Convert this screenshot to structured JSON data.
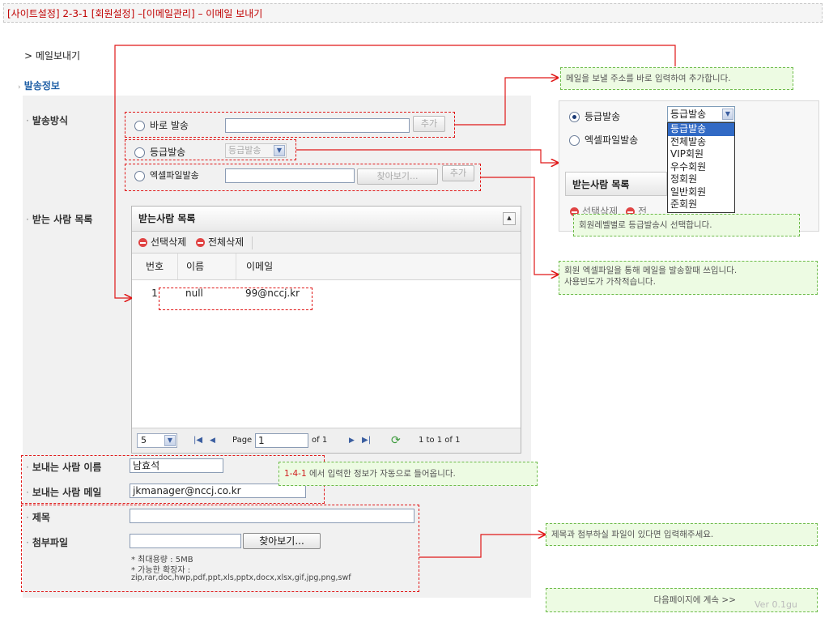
{
  "header": {
    "title": "[사이트설정] 2-3-1 [회원설정] –[이메일관리] – 이메일 보내기"
  },
  "breadcrumb": "> 메일보내기",
  "section_title": "발송정보",
  "send_method": {
    "label": "발송방식",
    "options": [
      {
        "label": "바로 발송",
        "button": "추가"
      },
      {
        "label": "등급발송",
        "select_value": "등급발송"
      },
      {
        "label": "엑셀파일발송",
        "browse": "찾아보기...",
        "button": "추가"
      }
    ]
  },
  "recipients": {
    "label": "받는 사람 목록",
    "grid_title": "받는사람 목록",
    "tools": [
      "선택삭제",
      "전체삭제"
    ],
    "columns": [
      "번호",
      "이름",
      "이메일"
    ],
    "rows": [
      {
        "no": "1",
        "name": "null",
        "email": "99@nccj.kr"
      }
    ],
    "pager": {
      "page_size": "5",
      "page_label": "Page",
      "page": "1",
      "of": "of 1",
      "range": "1 to 1 of 1"
    }
  },
  "sender_name": {
    "label": "보내는 사람 이름",
    "value": "남효석"
  },
  "sender_email": {
    "label": "보내는 사람 메일",
    "value": "jkmanager@nccj.co.kr"
  },
  "subject": {
    "label": "제목",
    "value": ""
  },
  "attachment": {
    "label": "첨부파일",
    "browse": "찾아보기...",
    "max": "* 최대용량 : 5MB",
    "ext_label": "* 가능한 확장자 :",
    "ext_list": "zip,rar,doc,hwp,pdf,ppt,xls,pptx,docx,xlsx,gif,jpg,png,swf"
  },
  "zoom_panel": {
    "option1": "등급발송",
    "option2": "엑셀파일발송",
    "select_value": "등급발송",
    "dropdown": [
      "등급발송",
      "전체발송",
      "VIP회원",
      "우수회원",
      "정회원",
      "일반회원",
      "준회원"
    ],
    "list_title": "받는사람 목록",
    "tool_partial": "선택삭제",
    "tool_partial2": "전"
  },
  "notes": {
    "direct": "메일을 보낼 주소를 바로 입력하여 추가합니다.",
    "grade": "회원레벨별로 등급발송시 선택합니다.",
    "excel_1": "회원 엑셀파일을 통해 메일을 발송할때 쓰입니다.",
    "excel_2": "사용빈도가 가작적습니다.",
    "sender_prefix": "1-4-1",
    "sender_text": "에서 입력한 정보가 자동으로 들어옵니다.",
    "attach": "제목과 첨부하실 파일이 있다면 입력해주세요.",
    "next": "다음페이지에 계속 >>",
    "version": "Ver 0.1gu"
  },
  "colors": {
    "accent_red": "#e01818",
    "note_green": "#6dbb4a",
    "section_blue": "#1f5fa6"
  }
}
